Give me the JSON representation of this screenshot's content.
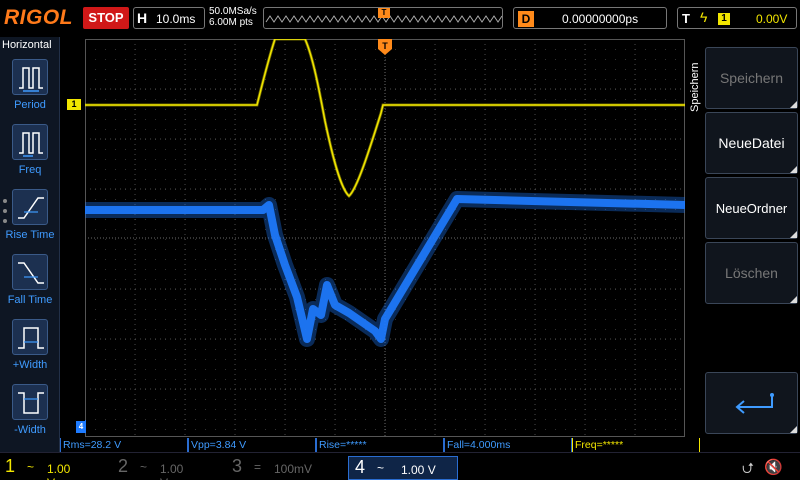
{
  "header": {
    "logo": "RIGOL",
    "run_status": "STOP",
    "timebase_label": "H",
    "timebase_value": "10.0ms",
    "sample_rate": "50.0MSa/s",
    "memory_depth": "6.00M pts",
    "trigger_pos_marker": "T",
    "delay_label": "D",
    "delay_value": "0.00000000ps",
    "trigger_label": "T",
    "trigger_source": "1",
    "trigger_level": "0.00V"
  },
  "left_menu": {
    "title": "Horizontal",
    "items": [
      {
        "label": "Period",
        "icon": "period-icon"
      },
      {
        "label": "Freq",
        "icon": "freq-icon"
      },
      {
        "label": "Rise Time",
        "icon": "rise-time-icon"
      },
      {
        "label": "Fall Time",
        "icon": "fall-time-icon"
      },
      {
        "label": "+Width",
        "icon": "pos-width-icon"
      },
      {
        "label": "-Width",
        "icon": "neg-width-icon"
      }
    ]
  },
  "markers": {
    "ch1_marker": "1",
    "ch4_marker": "4",
    "trigger_marker": "T"
  },
  "measurements": [
    {
      "text": "Rms=28.2 V",
      "color": "blue"
    },
    {
      "text": "Vpp=3.84 V",
      "color": "blue"
    },
    {
      "text": "Rise=*****",
      "color": "blue"
    },
    {
      "text": "Fall=4.000ms",
      "color": "blue"
    },
    {
      "text": "Freq=*****",
      "color": "yellow"
    }
  ],
  "channels": [
    {
      "num": "1",
      "coupling": "~",
      "scale": "1.00 V"
    },
    {
      "num": "2",
      "coupling": "~",
      "scale": "1.00 V"
    },
    {
      "num": "3",
      "coupling": "=",
      "scale": "100mV"
    },
    {
      "num": "4",
      "coupling": "~",
      "scale": "1.00 V"
    }
  ],
  "right_menu": {
    "side_label": "Speichern",
    "buttons": [
      {
        "label": "Speichern",
        "enabled": false
      },
      {
        "label": "NeueDatei",
        "enabled": true
      },
      {
        "label": "NeueOrdner",
        "enabled": true
      },
      {
        "label": "Löschen",
        "enabled": false
      }
    ],
    "back_icon": "return-arrow-icon"
  },
  "colors": {
    "ch1": "#f2e600",
    "ch4": "#1e7bff",
    "logo": "#ff7a1a",
    "stop": "#d01818",
    "menu_blue": "#3f9bff"
  },
  "status_icons": [
    "usb-icon",
    "speaker-muted-icon"
  ]
}
